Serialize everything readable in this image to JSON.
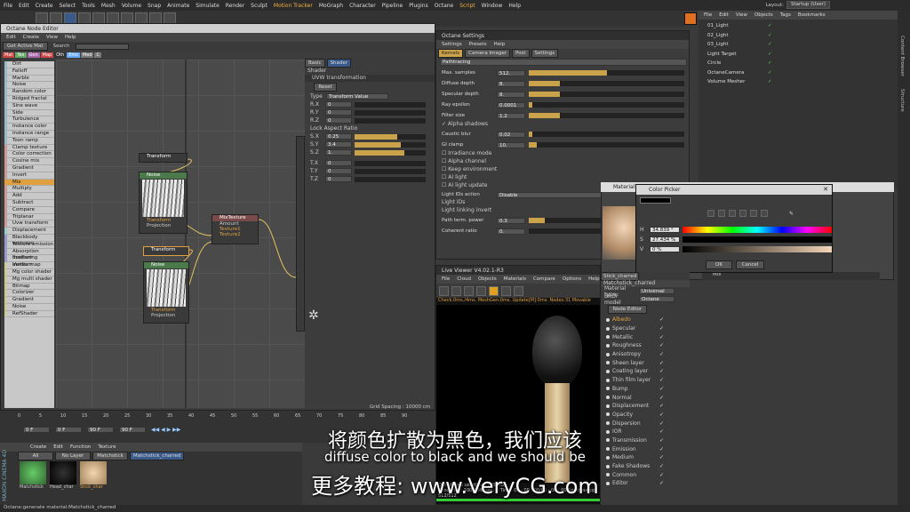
{
  "menubar": [
    "File",
    "Edit",
    "Create",
    "Select",
    "Tools",
    "Mesh",
    "Volume",
    "Snap",
    "Animate",
    "Simulate",
    "Render",
    "Sculpt",
    "Motion Tracker",
    "MoGraph",
    "Character",
    "Pipeline",
    "Plugins",
    "Octane",
    "Script",
    "Window",
    "Help"
  ],
  "layout": {
    "label": "Layout:",
    "value": "Startup (User)"
  },
  "node_editor": {
    "title": "Octane Node Editor",
    "menu": [
      "Edit",
      "Create",
      "View",
      "Help"
    ],
    "get_active": "Get Active Mat",
    "search": "Search",
    "tabs": [
      "Mat",
      "Tex",
      "Gen",
      "Map",
      "Oth",
      "Ems",
      "Med",
      "C"
    ],
    "items": [
      "Dirt",
      "Falloff",
      "Marble",
      "Noise",
      "Random color",
      "Ridged fractal",
      "Sine wave",
      "Side",
      "Turbulence",
      "Instance color",
      "Instance range",
      "Toon ramp",
      "Clamp texture",
      "Color correction",
      "Cosine mix",
      "Gradient",
      "Invert",
      "Mix",
      "Multiply",
      "Add",
      "Subtract",
      "Compare",
      "Triplanar",
      "Uvw transform",
      "Displacement",
      "Blackbody emission",
      "Texture emission",
      "Absorption medium",
      "Scattering medium",
      "Vertex map",
      "Mg color shader",
      "Mg multi shader",
      "Bitmap",
      "Colorizer",
      "Gradient",
      "Noise",
      "RefShader"
    ],
    "nodes": {
      "transform": "Transform",
      "noise": "Noise",
      "mix": "MixTexture",
      "amount": "Amount",
      "tex1": "Texture1",
      "tex2": "Texture2",
      "projection": "Projection"
    },
    "shader": {
      "tabs": [
        "Basic",
        "Shader"
      ],
      "section": "Shader",
      "uvw": "UVW transformation",
      "reset": "Reset",
      "type_label": "Type",
      "type_value": "Transform Value",
      "rows": [
        {
          "k": "R.X",
          "v": "0"
        },
        {
          "k": "R.Y",
          "v": "0"
        },
        {
          "k": "R.Z",
          "v": "0"
        }
      ],
      "lock": "Lock Aspect Ratio",
      "srows": [
        {
          "k": "S.X",
          "v": "0.25",
          "f": 0.6
        },
        {
          "k": "S.Y",
          "v": "3.4",
          "f": 0.65
        },
        {
          "k": "S.Z",
          "v": "1.",
          "f": 0.7
        }
      ],
      "trows": [
        {
          "k": "T.X",
          "v": "0"
        },
        {
          "k": "T.Y",
          "v": "0"
        },
        {
          "k": "T.Z",
          "v": "0"
        }
      ]
    },
    "grid": "Grid Spacing : 10000 cm"
  },
  "octane_settings": {
    "title": "Octane Settings",
    "menu": [
      "Settings",
      "Presets",
      "Help"
    ],
    "tabs": [
      "Kernels",
      "Camera Imager",
      "Post",
      "Settings"
    ],
    "mode": "Pathtracing",
    "params": [
      {
        "k": "Max. samples",
        "v": "512.",
        "f": 0.5
      },
      {
        "k": "Diffuse depth",
        "v": "8.",
        "f": 0.2
      },
      {
        "k": "Specular depth",
        "v": "8.",
        "f": 0.2
      },
      {
        "k": "Ray epsilon",
        "v": "0.0001",
        "f": 0.02
      },
      {
        "k": "Filter size",
        "v": "1.2",
        "f": 0.2
      }
    ],
    "alpha_shadows": "Alpha shadows",
    "params2": [
      {
        "k": "Caustic blur",
        "v": "0.02",
        "f": 0.02
      },
      {
        "k": "GI clamp",
        "v": "10.",
        "f": 0.05
      }
    ],
    "checks": [
      "Irradiance mode",
      "Alpha channel",
      "Keep environment",
      "AI light",
      "AI light update"
    ],
    "ai_ids": "Light IDs action",
    "ai_ids_val": "Disable",
    "light_ids": "Light IDs",
    "linking": "Light linking invert",
    "path_term": "Path term. power",
    "path_val": "0.3",
    "coherent": "Coherent ratio",
    "coherent_val": "0."
  },
  "color_picker": {
    "title": "Color Picker",
    "mat_title": "Material",
    "H": "34.839 °",
    "S": "27.434 %",
    "V": "0 %",
    "ok": "OK",
    "cancel": "Cancel",
    "mix": "Mix"
  },
  "objects": {
    "menu": [
      "File",
      "Edit",
      "View",
      "Objects",
      "Tags",
      "Bookmarks"
    ],
    "items": [
      "01_Light",
      "02_Light",
      "03_Light",
      "Light Target",
      "Circle",
      "OctaneCamera",
      "Volume Mesher"
    ]
  },
  "live_viewer": {
    "title": "Live Viewer V4.02.1-R3",
    "menu": [
      "File",
      "Cloud",
      "Objects",
      "Materials",
      "Compare",
      "Options",
      "Help"
    ],
    "status": "Check:0ms./4ms. MeshGen:0ms. Update[M]:0ms. Nodes:31 Movable",
    "footer1": "Out-of-core used/max 0Kb/4Gb",
    "footer2": "Rendering: 100% Ms/sec: 0 Time: 00 : 00 : 00/00 : 00 : 00 Spp/maxspp: 512/512"
  },
  "material": {
    "tab": "Stick_charred",
    "path": "Matchstick_charred",
    "type_label": "Material type",
    "type": "Universal",
    "brdf_label": "BRDF model",
    "brdf": "Octane",
    "node_editor": "Node Editor",
    "channels": [
      "Albedo",
      "Specular",
      "Metallic",
      "Roughness",
      "Anisotropy",
      "Sheen layer",
      "Coating layer",
      "Thin film layer",
      "Bump",
      "Normal",
      "Displacement",
      "Opacity",
      "Dispersion",
      "IOR",
      "Transmission",
      "Emission",
      "Medium",
      "Fake Shadows",
      "Common",
      "Editor"
    ]
  },
  "timeline": {
    "ticks": [
      "0",
      "5",
      "10",
      "15",
      "20",
      "25",
      "30",
      "35",
      "40",
      "45",
      "50",
      "55",
      "60",
      "65",
      "70",
      "75",
      "80",
      "85",
      "90"
    ],
    "f0": "0 F",
    "f0b": "0 F",
    "f90": "90 F",
    "f90b": "90 F"
  },
  "mat_manager": {
    "menu": [
      "Create",
      "Edit",
      "Function",
      "Texture"
    ],
    "tabs": [
      "All",
      "No Layer",
      "Matchstick",
      "Matchstick_charred"
    ],
    "mats": [
      "Matchstick",
      "Head_char",
      "Stick_char"
    ]
  },
  "status_bar": "Octane:generate material:Matchstick_charred",
  "subtitle": {
    "cn": "将颜色扩散为黑色，我们应该",
    "en": "diffuse color to black and we should be",
    "promo": "更多教程: www.VeryCG.com"
  },
  "brand": "MAXON CINEMA 4D",
  "side_tabs": [
    "Content Browser",
    "Structure"
  ]
}
